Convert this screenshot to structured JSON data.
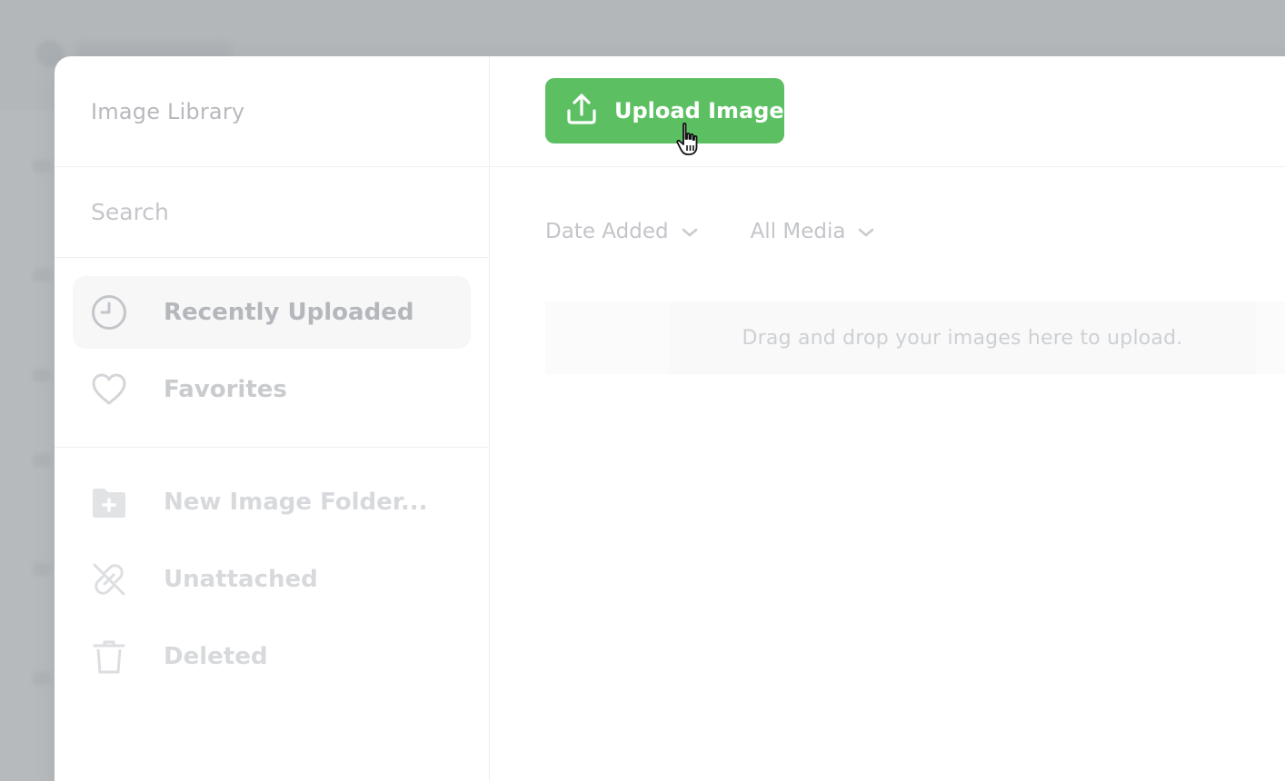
{
  "window": {
    "title": "Image Library"
  },
  "search": {
    "placeholder": "Search"
  },
  "sidebar": {
    "items": [
      {
        "label": "Recently Uploaded",
        "icon": "clock-icon",
        "active": true
      },
      {
        "label": "Favorites",
        "icon": "heart-icon",
        "active": false
      }
    ],
    "folders": [
      {
        "label": "New Image Folder...",
        "icon": "folder-plus-icon"
      },
      {
        "label": "Unattached",
        "icon": "unlink-icon"
      },
      {
        "label": "Deleted",
        "icon": "trash-icon"
      }
    ]
  },
  "toolbar": {
    "upload_label": "Upload Image",
    "upload_icon": "upload-icon"
  },
  "filters": {
    "sort_label": "Date Added",
    "type_label": "All Media"
  },
  "dropzone": {
    "text": "Drag and drop your images here to upload."
  },
  "colors": {
    "accent": "#5cc063",
    "overlay": "#b6babd"
  }
}
